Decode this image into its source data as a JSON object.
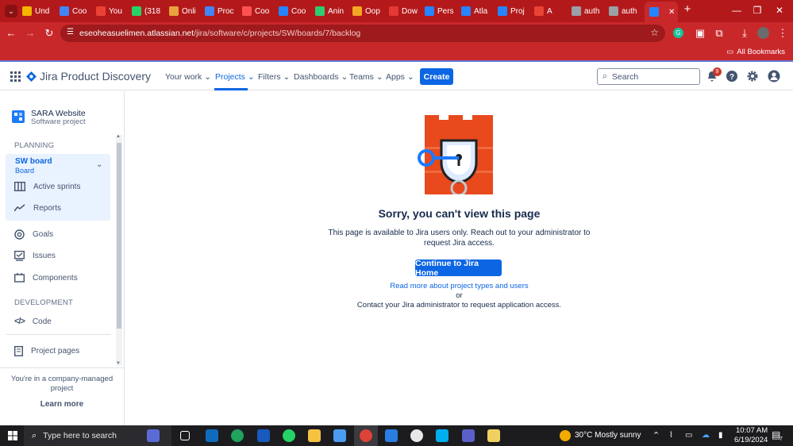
{
  "browser": {
    "tabs": [
      {
        "label": "Und",
        "color": "#f4b400"
      },
      {
        "label": "Coo",
        "color": "#4285f4"
      },
      {
        "label": "You",
        "color": "#ea4335"
      },
      {
        "label": "(318",
        "color": "#25d366"
      },
      {
        "label": "Onli",
        "color": "#e8a33d"
      },
      {
        "label": "Proc",
        "color": "#4285f4"
      },
      {
        "label": "Coo",
        "color": "#ff5252"
      },
      {
        "label": "Coo",
        "color": "#2684ff"
      },
      {
        "label": "Anin",
        "color": "#2ecc71"
      },
      {
        "label": "Oop",
        "color": "#f5a623"
      },
      {
        "label": "Dow",
        "color": "#e53935"
      },
      {
        "label": "Pers",
        "color": "#2684ff"
      },
      {
        "label": "Atla",
        "color": "#2684ff"
      },
      {
        "label": "Proj",
        "color": "#2684ff"
      },
      {
        "label": "A",
        "color": "#ea4335"
      },
      {
        "label": "auth",
        "color": "#9aa0a6"
      },
      {
        "label": "auth",
        "color": "#9aa0a6"
      }
    ],
    "url_host": "eseoheasuelimen.atlassian.net",
    "url_path": "/jira/software/c/projects/SW/boards/7/backlog",
    "bookmarks_label": "All Bookmarks"
  },
  "header": {
    "product_name": "Jira Product Discovery",
    "nav": [
      "Your work",
      "Projects",
      "Filters",
      "Dashboards",
      "Teams",
      "Apps"
    ],
    "create_label": "Create",
    "search_placeholder": "Search",
    "notification_count": "9"
  },
  "sidebar": {
    "project_name": "SARA Website",
    "project_type": "Software project",
    "planning_heading": "PLANNING",
    "board_name": "SW board",
    "board_sub": "Board",
    "active_sprints": "Active sprints",
    "reports": "Reports",
    "goals": "Goals",
    "issues": "Issues",
    "components": "Components",
    "development_heading": "DEVELOPMENT",
    "code": "Code",
    "project_pages": "Project pages",
    "footer_line1": "You're in a company-managed",
    "footer_line2": "project",
    "learn_more": "Learn more"
  },
  "main": {
    "title": "Sorry, you can't view this page",
    "desc_line1": "This page is available to Jira users only. Reach out to your administrator to",
    "desc_line2": "request Jira access.",
    "button": "Continue to Jira Home",
    "link": "Read more about project types and users",
    "or": "or",
    "contact": "Contact your Jira administrator to request application access."
  },
  "taskbar": {
    "search_placeholder": "Type here to search",
    "weather": "30°C  Mostly sunny",
    "time": "10:07 AM",
    "date": "6/19/2024",
    "notif_count": "7"
  },
  "colors": {
    "accent": "#0c66e4",
    "browser": "#c9282b",
    "castle": "#e8491d"
  }
}
